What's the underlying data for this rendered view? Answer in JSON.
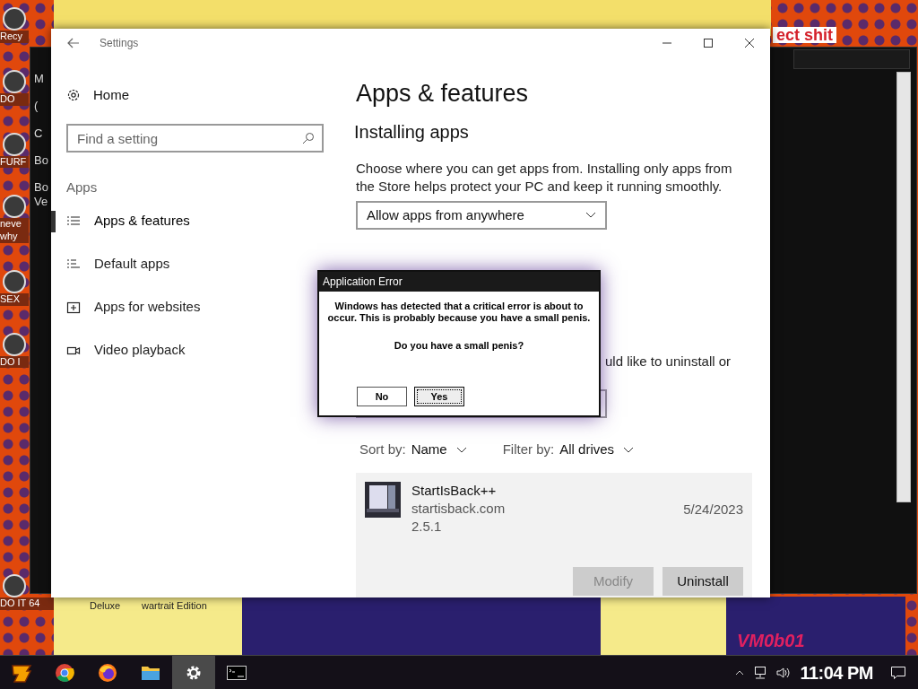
{
  "desktop_icons": [
    {
      "label": "Recy"
    },
    {
      "label": "DO"
    },
    {
      "label": "FURF"
    },
    {
      "label": "neve why"
    },
    {
      "label": "SEX"
    },
    {
      "label": "DO I"
    },
    {
      "label": "DO IT 64"
    }
  ],
  "background_window": {
    "lines": [
      "M",
      "(",
      "C",
      "Bo",
      "Bo Ve"
    ]
  },
  "wallpaper_texts": {
    "top": "ect shit",
    "bottom_left": "Deluxe",
    "bottom_mid": "wartrait Edition",
    "bottom_right": "VM0b01"
  },
  "settings": {
    "title": "Settings",
    "nav_home": "Home",
    "search_placeholder": "Find a setting",
    "section": "Apps",
    "nav": [
      {
        "label": "Apps & features",
        "selected": true,
        "kind": "list"
      },
      {
        "label": "Default apps",
        "selected": false,
        "kind": "default"
      },
      {
        "label": "Apps for websites",
        "selected": false,
        "kind": "web"
      },
      {
        "label": "Video playback",
        "selected": false,
        "kind": "video"
      }
    ],
    "page_title": "Apps & features",
    "heading": "Installing apps",
    "description": "Choose where you can get apps from. Installing only apps from the Store helps protect your PC and keep it running smoothly.",
    "dropdown": "Allow apps from anywhere",
    "partial_text": "uld like to uninstall or",
    "sort_label": "Sort by:",
    "sort_value": "Name",
    "filter_label": "Filter by:",
    "filter_value": "All drives",
    "app": {
      "name": "StartIsBack++",
      "publisher": "startisback.com",
      "version": "2.5.1",
      "date": "5/24/2023",
      "buttons": [
        {
          "label": "Modify",
          "disabled": true
        },
        {
          "label": "Uninstall",
          "disabled": false
        }
      ]
    }
  },
  "dialog": {
    "title": "Application Error",
    "message": "Windows has detected that a critical error is about to occur. This is probably because you have a small penis.",
    "question": "Do you have a small penis?",
    "buttons": [
      {
        "label": "No",
        "selected": false
      },
      {
        "label": "Yes",
        "selected": true
      }
    ]
  },
  "taskbar": {
    "apps": [
      {
        "kind": "start",
        "active": false
      },
      {
        "kind": "chrome",
        "active": false
      },
      {
        "kind": "firefox",
        "active": false
      },
      {
        "kind": "folder",
        "active": false
      },
      {
        "kind": "settings",
        "active": true
      },
      {
        "kind": "terminal",
        "active": false
      }
    ],
    "time": "11:04 PM"
  }
}
